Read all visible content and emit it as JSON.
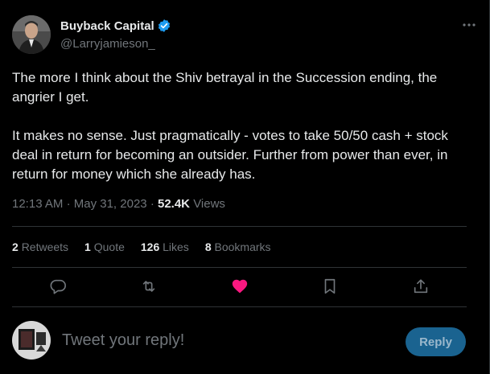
{
  "author": {
    "display_name": "Buyback Capital",
    "handle": "@Larryjamieson_"
  },
  "tweet": {
    "paragraphs": [
      "The more I think about the Shiv betrayal in the Succession ending, the angrier I get.",
      "It makes no sense. Just pragmatically - votes to take 50/50 cash + stock deal in return for becoming an outsider. Further from power than ever, in return for money which she already has."
    ],
    "time": "12:13 AM",
    "date": "May 31, 2023",
    "views_count": "52.4K",
    "views_label": "Views"
  },
  "stats": {
    "retweets_count": "2",
    "retweets_label": "Retweets",
    "quotes_count": "1",
    "quotes_label": "Quote",
    "likes_count": "126",
    "likes_label": "Likes",
    "bookmarks_count": "8",
    "bookmarks_label": "Bookmarks"
  },
  "actions": {
    "reply_icon": "reply-icon",
    "retweet_icon": "retweet-icon",
    "like_icon": "heart-icon",
    "bookmark_icon": "bookmark-icon",
    "share_icon": "share-icon"
  },
  "reply": {
    "placeholder": "Tweet your reply!",
    "button_label": "Reply"
  },
  "colors": {
    "background": "#000000",
    "text": "#e7e9ea",
    "muted": "#71767b",
    "divider": "#2f3336",
    "verified": "#1d9bf0",
    "like": "#f91880",
    "reply_button": "#1a6390"
  }
}
